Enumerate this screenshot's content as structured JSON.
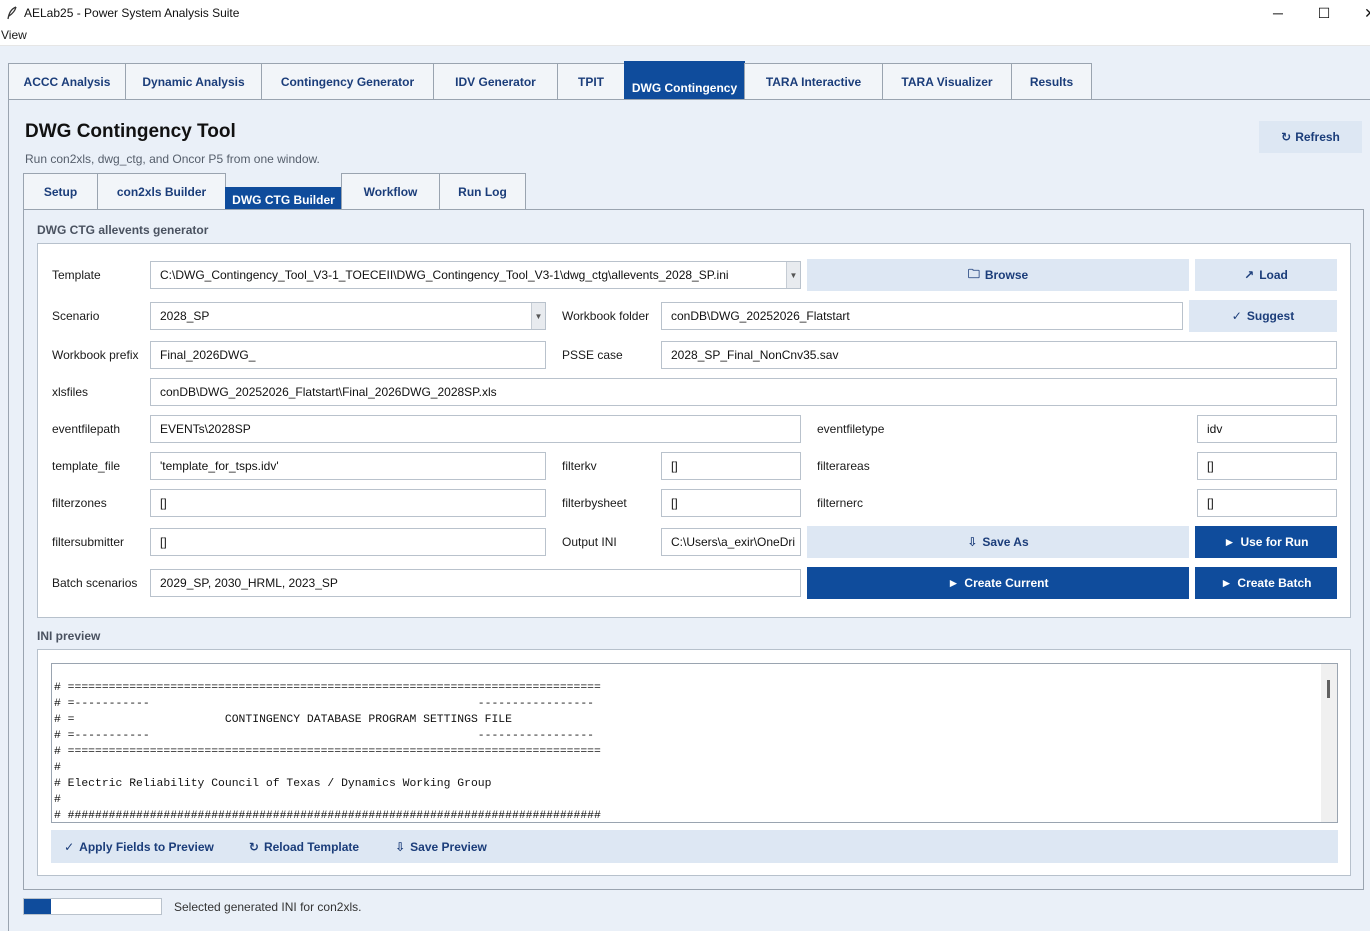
{
  "window": {
    "title": "AELab25 - Power System Analysis Suite",
    "icon": "feather-icon",
    "minimize_glyph": "─",
    "maximize_glyph": "☐",
    "close_glyph": "✕"
  },
  "menu": {
    "items": [
      {
        "label": "View"
      }
    ]
  },
  "main_tabs": [
    {
      "label": "ACCC Analysis"
    },
    {
      "label": "Dynamic Analysis"
    },
    {
      "label": "Contingency Generator"
    },
    {
      "label": "IDV Generator"
    },
    {
      "label": "TPIT"
    },
    {
      "label": "DWG Contingency",
      "active": true
    },
    {
      "label": "TARA Interactive"
    },
    {
      "label": "TARA Visualizer"
    },
    {
      "label": "Results"
    }
  ],
  "page": {
    "title": "DWG Contingency Tool",
    "subtitle": "Run con2xls, dwg_ctg, and Oncor P5 from one window.",
    "refresh": {
      "icon": "↻",
      "label": "Refresh"
    }
  },
  "sub_tabs": [
    {
      "label": "Setup"
    },
    {
      "label": "con2xls Builder"
    },
    {
      "label": "DWG CTG Builder",
      "active": true
    },
    {
      "label": "Workflow"
    },
    {
      "label": "Run Log"
    }
  ],
  "generator": {
    "section_label": "DWG CTG allevents generator",
    "template": {
      "label": "Template",
      "value": "C:\\DWG_Contingency_Tool_V3-1_TOECEII\\DWG_Contingency_Tool_V3-1\\dwg_ctg\\allevents_2028_SP.ini"
    },
    "browse": {
      "icon": "🗀",
      "label": "Browse"
    },
    "load": {
      "icon": "↗",
      "label": "Load"
    },
    "scenario": {
      "label": "Scenario",
      "value": "2028_SP"
    },
    "workbook_folder": {
      "label": "Workbook folder",
      "value": "conDB\\DWG_20252026_Flatstart"
    },
    "suggest": {
      "icon": "✓",
      "label": "Suggest"
    },
    "workbook_prefix": {
      "label": "Workbook prefix",
      "value": "Final_2026DWG_"
    },
    "psse_case": {
      "label": "PSSE case",
      "value": "2028_SP_Final_NonCnv35.sav"
    },
    "xlsfiles": {
      "label": "xlsfiles",
      "value": "conDB\\DWG_20252026_Flatstart\\Final_2026DWG_2028SP.xls"
    },
    "eventfilepath": {
      "label": "eventfilepath",
      "value": "EVENTs\\2028SP"
    },
    "eventfiletype": {
      "label": "eventfiletype",
      "value": "idv"
    },
    "template_file": {
      "label": "template_file",
      "value": "'template_for_tsps.idv'"
    },
    "filterkv": {
      "label": "filterkv",
      "value": "[]"
    },
    "filterareas": {
      "label": "filterareas",
      "value": "[]"
    },
    "filterzones": {
      "label": "filterzones",
      "value": "[]"
    },
    "filterbysheet": {
      "label": "filterbysheet",
      "value": "[]"
    },
    "filternerc": {
      "label": "filternerc",
      "value": "[]"
    },
    "filtersubmitter": {
      "label": "filtersubmitter",
      "value": "[]"
    },
    "output_ini": {
      "label": "Output INI",
      "value": "C:\\Users\\a_exir\\OneDri"
    },
    "save_as": {
      "icon": "⇩",
      "label": "Save As"
    },
    "use_for_run": {
      "icon": "►",
      "label": "Use for Run"
    },
    "batch_scenarios": {
      "label": "Batch scenarios",
      "value": "2029_SP, 2030_HRML, 2023_SP"
    },
    "create_current": {
      "icon": "►",
      "label": "Create Current"
    },
    "create_batch": {
      "icon": "►",
      "label": "Create Batch"
    }
  },
  "preview": {
    "section_label": "INI preview",
    "text": "# ==============================================================================\n# =-----------                                                -----------------\n# =                      CONTINGENCY DATABASE PROGRAM SETTINGS FILE\n# =-----------                                                -----------------\n# ==============================================================================\n#\n# Electric Reliability Council of Texas / Dynamics Working Group\n#\n# ##############################################################################",
    "apply_fields": {
      "icon": "✓",
      "label": "Apply Fields to Preview"
    },
    "reload_template": {
      "icon": "↻",
      "label": "Reload Template"
    },
    "save_preview": {
      "icon": "⇩",
      "label": "Save Preview"
    }
  },
  "status": {
    "progress": 0.2,
    "message": "Selected generated INI for con2xls."
  }
}
